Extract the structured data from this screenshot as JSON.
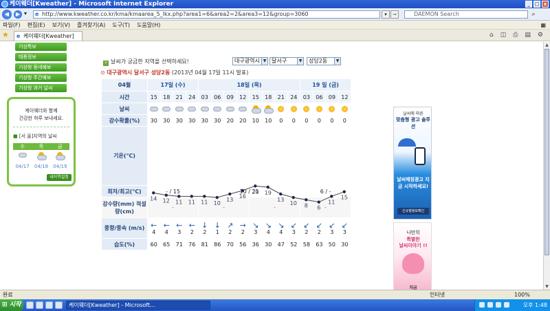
{
  "window": {
    "title": "케이웨더[Kweather] - Microsoft Internet Explorer",
    "url": "http://www.kweather.co.kr/kma/kmaarea_5_lkx.php?area1=6&area2=2&area3=12&group=3060",
    "search_placeholder": "DAEMON Search",
    "tab_title": "케이웨더[Kweather]"
  },
  "menu": [
    "파일(F)",
    "편집(E)",
    "보기(V)",
    "즐겨찾기(A)",
    "도구(T)",
    "도움말(H)"
  ],
  "sidebar": {
    "links": [
      "기상특보",
      "태풍정보",
      "기상청 동네예보",
      "기상청 주간예보",
      "기상청 과거 날씨"
    ],
    "box_message": [
      "케이웨더와 함께",
      "건강한 하루 보내세요."
    ],
    "region_label": "[서 울]지역의 날씨",
    "region_prefix": "■",
    "days": [
      "수",
      "목",
      "금"
    ],
    "dates": [
      "04/17",
      "04/18",
      "04/19"
    ],
    "set_button": "내지역설정"
  },
  "main": {
    "prompt": "날씨가 궁금한 지역을 선택하세요!",
    "prompt_icon": "+",
    "selects": [
      "대구광역시",
      "달서구",
      "성당2동"
    ],
    "location": "대구광역시 달서구 성당2동",
    "issued": "(2013년 04월 17일 11시 발표)",
    "location_prefix": "⊙"
  },
  "table": {
    "month_label": "04월",
    "days": [
      {
        "label": "17일 (수)",
        "span": 4
      },
      {
        "label": "18일 (목)",
        "span": 8
      },
      {
        "label": "19 일 (금)",
        "span": 4
      }
    ],
    "row_labels": {
      "time": "시간",
      "weather": "날씨",
      "precip_prob": "강수확률(%)",
      "temp": "기온(℃)",
      "minmax": "최저/최고(℃)",
      "precip_amt": "강수량(mm) 적설량(cm)",
      "wind": "풍향/풍속 (m/s)",
      "humidity": "습도(%)"
    },
    "times": [
      "15",
      "18",
      "21",
      "24",
      "03",
      "06",
      "09",
      "12",
      "15",
      "18",
      "21",
      "24",
      "03",
      "06",
      "09",
      "12"
    ],
    "weather_icons": [
      "cloud-icon",
      "cloud-icon",
      "cloud-icon",
      "cloud-icon",
      "cloud-icon",
      "cloud-icon",
      "cloud-icon",
      "cloud-icon",
      "partly-cloudy-icon",
      "partly-cloudy-icon",
      "sun-icon",
      "sun-icon",
      "sun-icon",
      "sun-icon",
      "sun-icon",
      "sun-icon"
    ],
    "precip_prob": [
      "30",
      "30",
      "30",
      "30",
      "30",
      "30",
      "20",
      "20",
      "10",
      "10",
      "0",
      "0",
      "0",
      "0",
      "0",
      "0"
    ],
    "temps": [
      14,
      12,
      11,
      11,
      11,
      10,
      13,
      16,
      20,
      19,
      13,
      10,
      8,
      6,
      11,
      15
    ],
    "minmax": [
      {
        "text": "- / 15",
        "span": 4
      },
      {
        "text": "10 / 21",
        "span": 8
      },
      {
        "text": "6 / -",
        "span": 4
      }
    ],
    "precip_amt": [
      "-",
      "-",
      "-",
      "-"
    ],
    "wind_arrows": [
      "←",
      "←",
      "←",
      "←",
      "↓",
      "↓",
      "↗",
      "→",
      "↘",
      "↘",
      "↘",
      "↙",
      "↙",
      "↙",
      "↙",
      "↙"
    ],
    "wind_speeds": [
      "4",
      "4",
      "3",
      "2",
      "2",
      "1",
      "2",
      "2",
      "3",
      "4",
      "4",
      "3",
      "2",
      "2",
      "3",
      "3"
    ],
    "humidity": [
      "60",
      "65",
      "71",
      "76",
      "81",
      "86",
      "70",
      "56",
      "36",
      "30",
      "47",
      "52",
      "58",
      "63",
      "50",
      "30"
    ]
  },
  "ads": {
    "ad1_line1": "날씨에 따른",
    "ad1_line2": "맞춤형 광고 솔루션",
    "ad1_line3": "날씨매칭광고 지금 시작하세요!",
    "ad1_button": "신규행정보확인",
    "ad2_line1": "나만의",
    "ad2_line2": "특별한",
    "ad2_line3": "날씨이야기 !!",
    "ad2_footer": "지금"
  },
  "status": {
    "left": "완료",
    "zone": "인터넷",
    "zoom": "100%"
  },
  "taskbar": {
    "start": "시작",
    "window": "케이웨더[Kweather] - Microsoft...",
    "clock": "오후 1:48"
  }
}
